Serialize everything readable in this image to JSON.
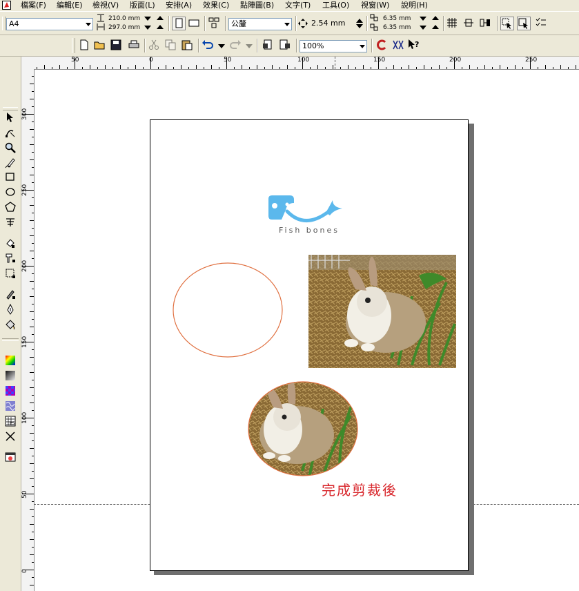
{
  "menu": {
    "items": [
      "檔案(F)",
      "編輯(E)",
      "檢視(V)",
      "版面(L)",
      "安排(A)",
      "效果(C)",
      "點陣圖(B)",
      "文字(T)",
      "工具(O)",
      "視窗(W)",
      "說明(H)"
    ]
  },
  "property_bar": {
    "page_size": "A4",
    "width": "210.0 mm",
    "height": "297.0 mm",
    "units": "公釐",
    "nudge": "2.54 mm",
    "dup_x": "6.35 mm",
    "dup_y": "6.35 mm"
  },
  "standard_toolbar": {
    "zoom": "100%"
  },
  "rulers": {
    "horizontal_labels": [
      "50",
      "0",
      "50",
      "100",
      "150",
      "200",
      "250"
    ],
    "vertical_labels": [
      "300",
      "250",
      "200",
      "150",
      "100",
      "50",
      "0"
    ]
  },
  "document": {
    "logo_text": "Fish bones",
    "caption": "完成剪裁後"
  },
  "colors": {
    "ellipse_outline": "#e07040",
    "logo_blue": "#5bb8ec",
    "caption_red": "#d8262b"
  },
  "icons": {
    "toolbox": [
      "pick-tool-icon",
      "shape-tool-icon",
      "zoom-tool-icon",
      "freehand-tool-icon",
      "rectangle-tool-icon",
      "ellipse-tool-icon",
      "polygon-tool-icon",
      "text-tool-icon",
      "interactive-fill-icon",
      "eyedropper-icon",
      "transparency-icon",
      "outline-pen-icon",
      "pen-icon",
      "fill-bucket-icon",
      "color-swatch-icon",
      "gradient-swatch-icon",
      "pattern-swatch-icon",
      "texture-swatch-icon",
      "postscript-swatch-icon",
      "no-fill-icon",
      "color-docker-icon"
    ]
  }
}
